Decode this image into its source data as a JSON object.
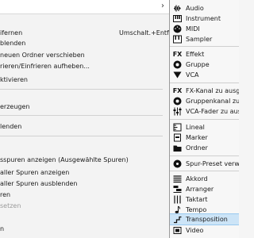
{
  "parent_menu": {
    "items": [
      {
        "label": "ifernen",
        "shortcut": "Umschalt.+Entf."
      },
      {
        "label": "blenden"
      },
      {
        "label": "neuen Ordner verschieben"
      },
      {
        "label": "rieren/Einfrieren aufheben..."
      },
      {
        "label": "ktivieren"
      },
      {
        "label": "erzeugen"
      },
      {
        "label": "lenden"
      },
      {
        "label": "sspuren anzeigen (Ausgewählte Spuren)"
      },
      {
        "label": "aller Spuren anzeigen"
      },
      {
        "label": "aller Spuren ausblenden"
      },
      {
        "label": "ren"
      },
      {
        "label": "setzen",
        "disabled": true
      },
      {
        "label": "n"
      }
    ]
  },
  "submenu": {
    "items": [
      {
        "label": "Audio",
        "icon": "waveform-icon"
      },
      {
        "label": "Instrument",
        "icon": "keyboard-icon"
      },
      {
        "label": "MIDI",
        "icon": "midi-icon"
      },
      {
        "label": "Sampler",
        "icon": "sampler-icon"
      },
      {
        "label": "Effekt",
        "icon": "fx-icon",
        "glyph": "FX"
      },
      {
        "label": "Gruppe",
        "icon": "group-icon"
      },
      {
        "label": "VCA",
        "icon": "vca-icon"
      },
      {
        "label": "FX-Kanal zu ausgew",
        "icon": "fx-channel-icon",
        "glyph": "FX"
      },
      {
        "label": "Gruppenkanal zu aus",
        "icon": "group-channel-icon"
      },
      {
        "label": "VCA-Fader zu ausge",
        "icon": "vca-fader-icon"
      },
      {
        "label": "Lineal",
        "icon": "ruler-icon"
      },
      {
        "label": "Marker",
        "icon": "marker-icon"
      },
      {
        "label": "Ordner",
        "icon": "folder-icon"
      },
      {
        "label": "Spur-Preset verwend",
        "icon": "preset-icon"
      },
      {
        "label": "Akkord",
        "icon": "chord-icon"
      },
      {
        "label": "Arranger",
        "icon": "arranger-icon"
      },
      {
        "label": "Taktart",
        "icon": "time-signature-icon"
      },
      {
        "label": "Tempo",
        "icon": "tempo-icon"
      },
      {
        "label": "Transposition",
        "icon": "transpose-icon",
        "selected": true
      },
      {
        "label": "Video",
        "icon": "video-icon"
      }
    ]
  }
}
